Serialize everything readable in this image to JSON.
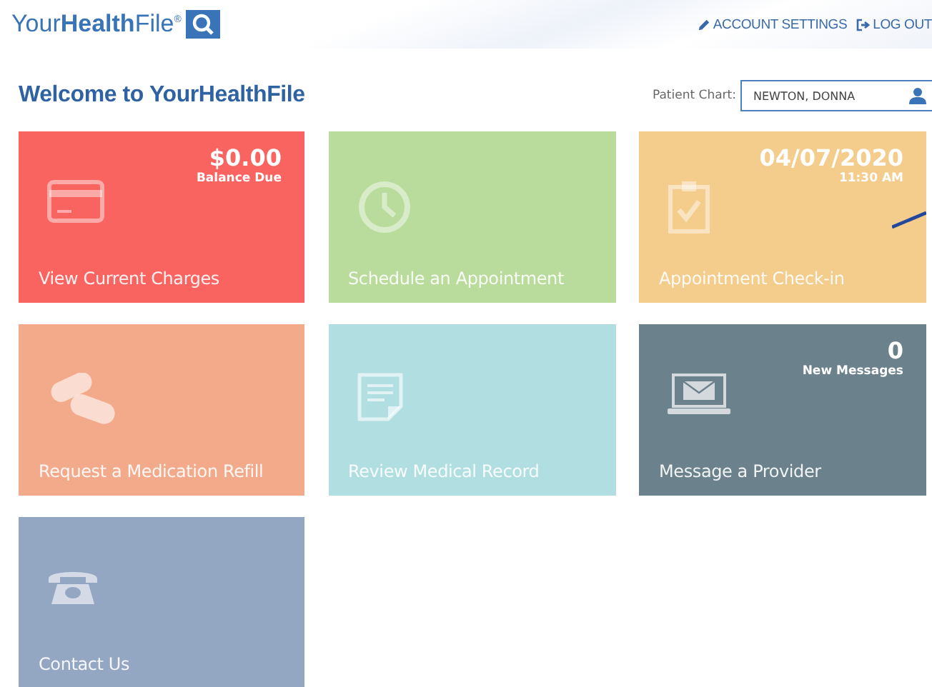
{
  "header": {
    "logo": "Your**Health**File$^{®}$",
    "links": [
      {
        "kind": "edit",
        "label": "ACCOUNT SETTINGS"
      },
      {
        "kind": "logout",
        "label": "LOG OUT"
      }
    ]
  },
  "welcome": "Welcome to YourHealthFile",
  "patient_chart": {
    "label": "Patient Chart:",
    "value": "NEWTON, DONNA"
  },
  "tiles": [
    {
      "kind": "card",
      "label": "View Current Charges",
      "color": "#f96461",
      "value": "$0.00",
      "sub": "Balance Due"
    },
    {
      "kind": "clock",
      "label": "Schedule an Appointment",
      "color": "#b9dc9d"
    },
    {
      "kind": "clipboard",
      "label": "Appointment Check-in",
      "color": "#f4cc8c",
      "value": "04/07/2020",
      "sub": "11:30 AM"
    },
    {
      "kind": "pills",
      "label": "Request a Medication Refill",
      "color": "#f2aa8b"
    },
    {
      "kind": "document",
      "label": "Review Medical Record",
      "color": "#b1dfe1"
    },
    {
      "kind": "laptop",
      "label": "Message a Provider",
      "color": "#6b818b",
      "value": "0",
      "sub": "New Messages"
    },
    {
      "kind": "phone",
      "label": "Contact Us",
      "color": "#93a6c2"
    }
  ]
}
